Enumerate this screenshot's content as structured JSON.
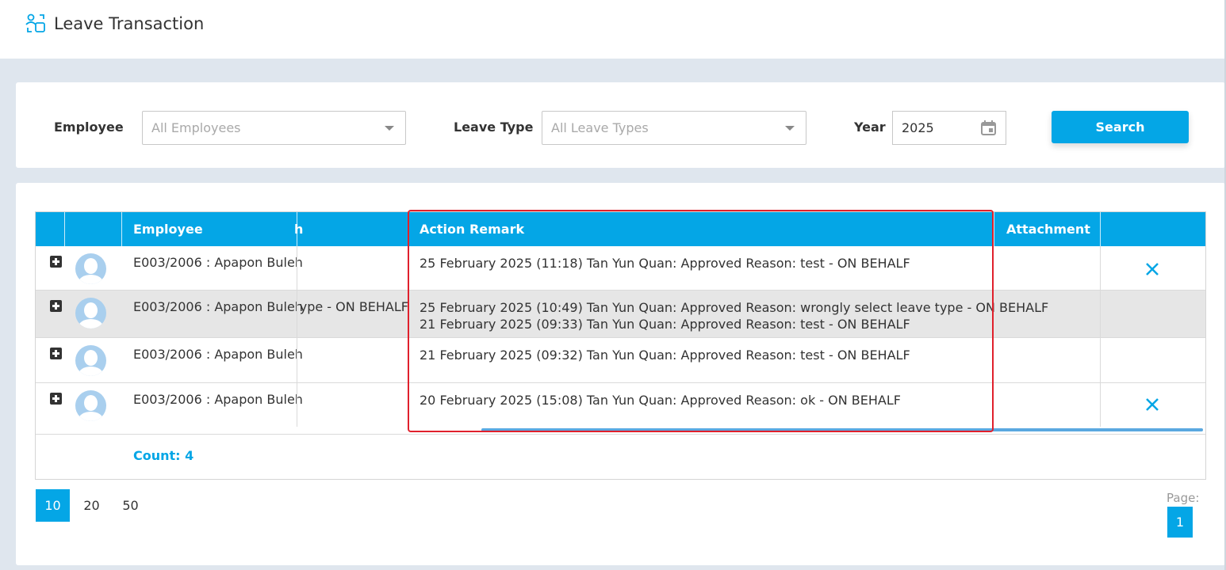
{
  "header": {
    "title": "Leave Transaction",
    "icon": "transaction-icon"
  },
  "filters": {
    "employee_label": "Employee",
    "employee_placeholder": "All Employees",
    "leave_type_label": "Leave Type",
    "leave_type_placeholder": "All Leave Types",
    "year_label": "Year",
    "year_value": "2025",
    "search_label": "Search"
  },
  "grid": {
    "columns": {
      "employee": "Employee",
      "hidden_partial": "h",
      "action_remark": "Action Remark",
      "attachment": "Attachment"
    },
    "rows": [
      {
        "employee": "E003/2006 : Apapon Buleh",
        "partial": "",
        "remark_lines": [
          "25 February 2025 (11:18) Tan Yun Quan: Approved Reason: test - ON BEHALF",
          ""
        ],
        "has_delete": true
      },
      {
        "employee": "E003/2006 : Apapon Buleh",
        "partial": "ype - ON BEHALF",
        "remark_lines": [
          "25 February 2025 (10:49) Tan Yun Quan: Approved Reason: wrongly select leave type - ON BEHALF",
          "21 February 2025 (09:33) Tan Yun Quan: Approved Reason: test - ON BEHALF"
        ],
        "has_delete": false
      },
      {
        "employee": "E003/2006 : Apapon Buleh",
        "partial": "",
        "remark_lines": [
          "21 February 2025 (09:32) Tan Yun Quan: Approved Reason: test - ON BEHALF",
          ""
        ],
        "has_delete": false
      },
      {
        "employee": "E003/2006 : Apapon Buleh",
        "partial": "",
        "remark_lines": [
          "20 February 2025 (15:08) Tan Yun Quan: Approved Reason: ok - ON BEHALF",
          ""
        ],
        "has_delete": true
      }
    ],
    "count_label": "Count: 4"
  },
  "pager": {
    "sizes": [
      "10",
      "20",
      "50"
    ],
    "active_size": "10",
    "page_label": "Page:",
    "current_page": "1"
  },
  "colors": {
    "accent": "#04a6e6",
    "highlight": "#e0202c"
  }
}
